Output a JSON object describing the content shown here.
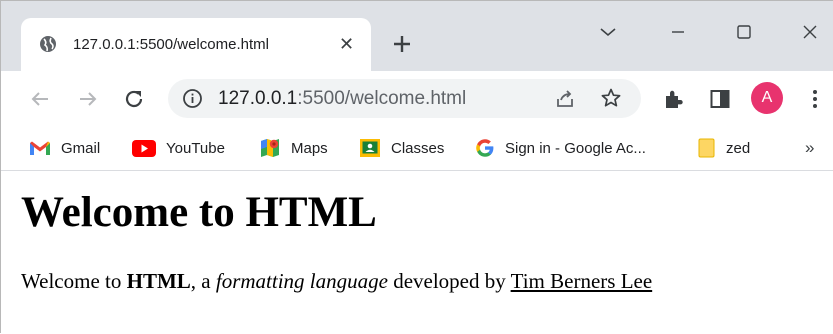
{
  "tab": {
    "title": "127.0.0.1:5500/welcome.html",
    "close": "✕"
  },
  "new_tab": "+",
  "omnibox": {
    "host": "127.0.0.1",
    "rest": ":5500/welcome.html"
  },
  "profile": {
    "initial": "A",
    "color": "#e8336e"
  },
  "bookmarks": [
    {
      "label": "Gmail",
      "icon": "gmail-icon"
    },
    {
      "label": "YouTube",
      "icon": "youtube-icon"
    },
    {
      "label": "Maps",
      "icon": "maps-icon"
    },
    {
      "label": "Classes",
      "icon": "classes-icon"
    },
    {
      "label": "Sign in - Google Ac...",
      "icon": "google-icon"
    },
    {
      "label": "zed",
      "icon": "folder-icon"
    }
  ],
  "bookmarks_overflow": "»",
  "page": {
    "heading": "Welcome to HTML",
    "para_start": "Welcome to ",
    "para_bold": "HTML",
    "para_mid": ", a ",
    "para_italic": "formatting language",
    "para_mid2": " developed by ",
    "para_link": "Tim Berners Lee"
  }
}
